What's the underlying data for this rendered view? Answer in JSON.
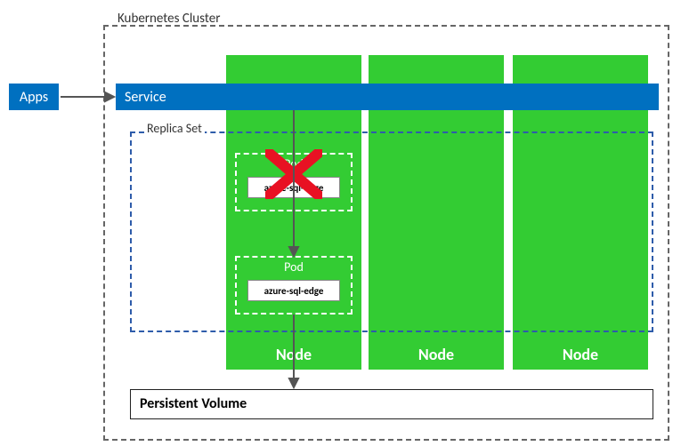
{
  "cluster": {
    "label": "Kubernetes Cluster"
  },
  "apps": {
    "label": "Apps"
  },
  "service": {
    "label": "Service"
  },
  "replicaset": {
    "label": "Replica Set"
  },
  "nodes": [
    {
      "label": "Node"
    },
    {
      "label": "Node"
    },
    {
      "label": "Node"
    }
  ],
  "pods": [
    {
      "label": "Pod",
      "workload": "azure-sql-edge",
      "failed": true
    },
    {
      "label": "Pod",
      "workload": "azure-sql-edge",
      "failed": false
    }
  ],
  "pv": {
    "label": "Persistent Volume"
  },
  "colors": {
    "node": "#33cc33",
    "service": "#0070c0",
    "apps": "#0070c0",
    "replicaset_border": "#2e5caa",
    "cluster_border": "#666666",
    "failed": "#e81123"
  }
}
